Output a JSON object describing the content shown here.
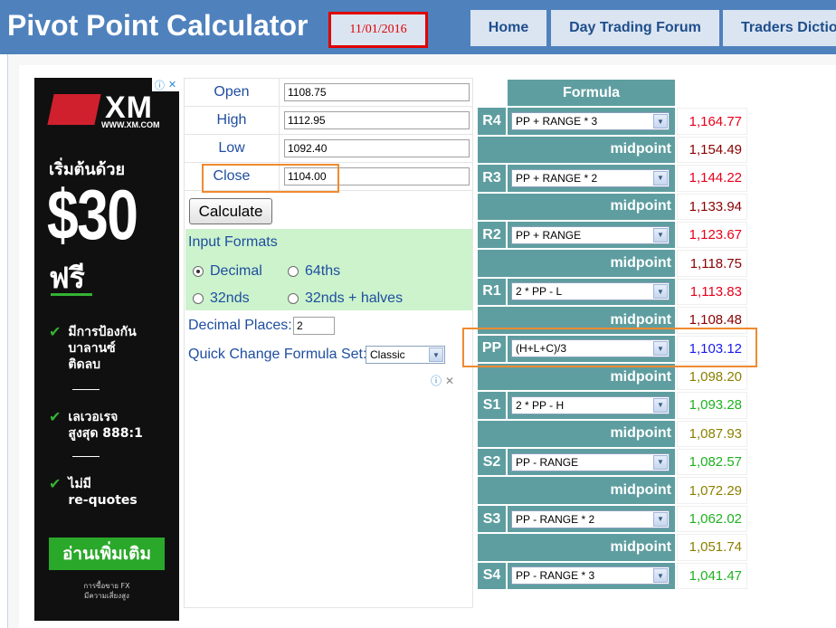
{
  "header": {
    "title": "Pivot Point Calculator",
    "date": "11/01/2016",
    "nav": [
      {
        "label": "Home"
      },
      {
        "label": "Day Trading Forum"
      },
      {
        "label": "Traders Dictio"
      }
    ]
  },
  "ad": {
    "brand": "XM",
    "site": "WWW.XM.COM",
    "start": "เริ่มต้นด้วย",
    "amount": "$30",
    "free": "ฟรี",
    "features": [
      {
        "line1": "มีการป้องกัน",
        "line2": "บาลานซ์",
        "line3": "ติดลบ"
      },
      {
        "line1": "เลเวอเรจ",
        "line2": "สูงสุด 888:1",
        "line3": ""
      },
      {
        "line1": "ไม่มี",
        "line2": "re-quotes",
        "line3": ""
      }
    ],
    "cta": "อ่านเพิ่มเติม",
    "disclaimer1": "การซื้อขาย FX",
    "disclaimer2": "มีความเสี่ยงสูง"
  },
  "form": {
    "open_label": "Open",
    "open_value": "1108.75",
    "high_label": "High",
    "high_value": "1112.95",
    "low_label": "Low",
    "low_value": "1092.40",
    "close_label": "Close",
    "close_value": "1104.00",
    "calculate_label": "Calculate",
    "input_formats_title": "Input Formats",
    "formats": [
      "Decimal",
      "64ths",
      "32nds",
      "32nds + halves"
    ],
    "selected_format": "Decimal",
    "decimal_places_label": "Decimal Places:",
    "decimal_places_value": "2",
    "quick_change_label": "Quick Change Formula Set:",
    "quick_change_value": "Classic"
  },
  "results": {
    "formula_header": "Formula",
    "midpoint_label": "midpoint",
    "rows": [
      {
        "level": "R4",
        "formula": "PP + RANGE * 3",
        "value": "1,164.77",
        "color": "#e8001c"
      },
      {
        "midpoint": "1,154.49",
        "color": "#8b0000"
      },
      {
        "level": "R3",
        "formula": "PP + RANGE * 2",
        "value": "1,144.22",
        "color": "#e8001c"
      },
      {
        "midpoint": "1,133.94",
        "color": "#8b0000"
      },
      {
        "level": "R2",
        "formula": "PP + RANGE",
        "value": "1,123.67",
        "color": "#e8001c"
      },
      {
        "midpoint": "1,118.75",
        "color": "#8b0000"
      },
      {
        "level": "R1",
        "formula": "2 * PP - L",
        "value": "1,113.83",
        "color": "#e8001c"
      },
      {
        "midpoint": "1,108.48",
        "color": "#8b0000"
      },
      {
        "level": "PP",
        "formula": "(H+L+C)/3",
        "value": "1,103.12",
        "color": "#1a1aee"
      },
      {
        "midpoint": "1,098.20",
        "color": "#8b8000"
      },
      {
        "level": "S1",
        "formula": "2 * PP - H",
        "value": "1,093.28",
        "color": "#20b020"
      },
      {
        "midpoint": "1,087.93",
        "color": "#8b8000"
      },
      {
        "level": "S2",
        "formula": "PP - RANGE",
        "value": "1,082.57",
        "color": "#20b020"
      },
      {
        "midpoint": "1,072.29",
        "color": "#8b8000"
      },
      {
        "level": "S3",
        "formula": "PP - RANGE * 2",
        "value": "1,062.02",
        "color": "#20b020"
      },
      {
        "midpoint": "1,051.74",
        "color": "#8b8000"
      },
      {
        "level": "S4",
        "formula": "PP - RANGE * 3",
        "value": "1,041.47",
        "color": "#20b020"
      }
    ]
  },
  "colors": {
    "header_bg": "#4f81bd",
    "table_teal": "#5f9ea0",
    "highlight": "#f08a30",
    "date_border": "#e00000",
    "formats_panel": "#ccf3cc"
  }
}
